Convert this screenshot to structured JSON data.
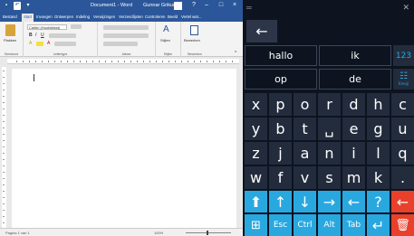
{
  "word": {
    "title": "Document1 - Word",
    "user": "Gunnar Grikud",
    "window_controls": [
      "?",
      "–",
      "□",
      "×"
    ],
    "tabs": [
      "Bestand",
      "Start",
      "Invoegen",
      "Ontwerpen",
      "Indeling",
      "Verwijzingen",
      "Verzendlijsten",
      "Controleren",
      "Beeld",
      "Vertel wat..."
    ],
    "active_tab": "Start",
    "ribbon_groups": [
      "Klembord",
      "Lettertype",
      "Alinea",
      "Stijlen",
      "Bewerken"
    ],
    "ribbon_labels": {
      "paste": "Plakken",
      "font": "Calibri (Hoofdtekst)",
      "styles": "Stijlen",
      "edit": "Bewerken"
    },
    "status": {
      "page": "Pagina 1 van 1",
      "zoom": "100%"
    }
  },
  "keyboard": {
    "minimize_glyph": "═",
    "close_glyph": "✕",
    "back_glyph": "←",
    "suggestions": [
      "hallo",
      "ik",
      "op",
      "de"
    ],
    "mode_123": "123",
    "emoji_label": "Emoji",
    "emoji_glyph": "☷",
    "rows": [
      [
        "x",
        "p",
        "o",
        "r",
        "d",
        "h",
        "c"
      ],
      [
        "y",
        "b",
        "t",
        "␣",
        "e",
        "g",
        "u"
      ],
      [
        "z",
        "j",
        "a",
        "n",
        "i",
        "l",
        "q"
      ],
      [
        "w",
        "f",
        "v",
        "s",
        "m",
        "k",
        "."
      ]
    ],
    "nav_row": [
      "⬆",
      "↑",
      "↓",
      "→",
      "←",
      "?",
      "←"
    ],
    "bottom_row": [
      "⊞",
      "Esc",
      "Ctrl",
      "Alt",
      "Tab",
      "↵",
      "🗑"
    ],
    "colors": {
      "background": "#0d1420",
      "key": "#232c3d",
      "accent": "#29a8e0",
      "danger": "#e8402a"
    }
  }
}
